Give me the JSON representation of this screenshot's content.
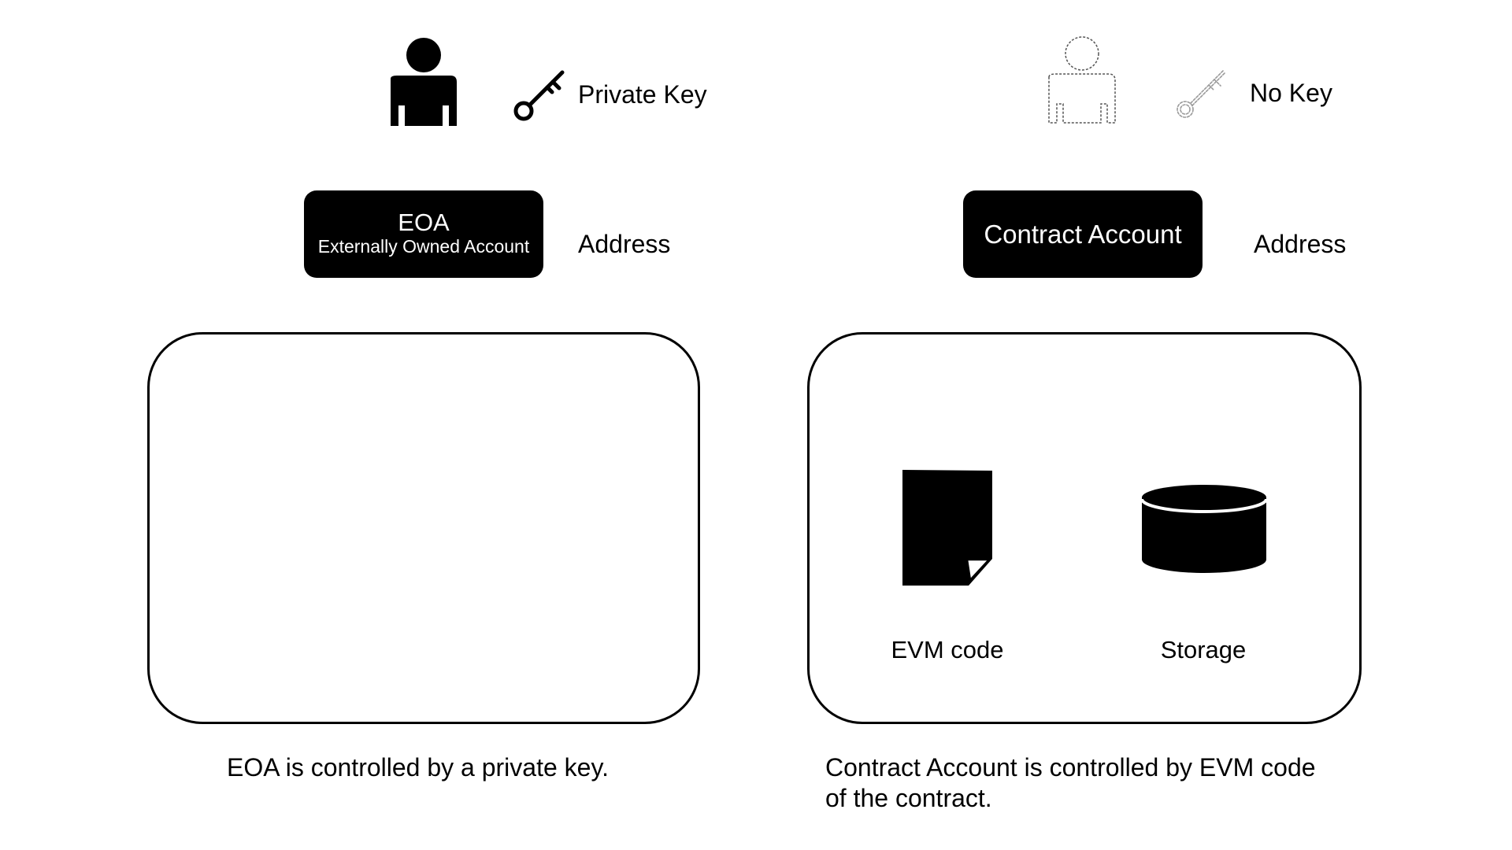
{
  "eoa": {
    "key_label": "Private Key",
    "box_title": "EOA",
    "box_subtitle": "Externally Owned Account",
    "address_label": "Address",
    "caption": "EOA is controlled by a private key."
  },
  "contract": {
    "key_label": "No Key",
    "box_title": "Contract Account",
    "address_label": "Address",
    "code_label": "EVM code",
    "storage_label": "Storage",
    "caption_line1": "Contract Account is controlled by EVM code",
    "caption_line2": "of the contract."
  },
  "icons": {
    "eoa_person": "person-icon",
    "eoa_key": "key-icon",
    "contract_person": "dashed-person-icon",
    "contract_key": "faded-key-icon",
    "code": "document-icon",
    "storage": "database-icon"
  }
}
